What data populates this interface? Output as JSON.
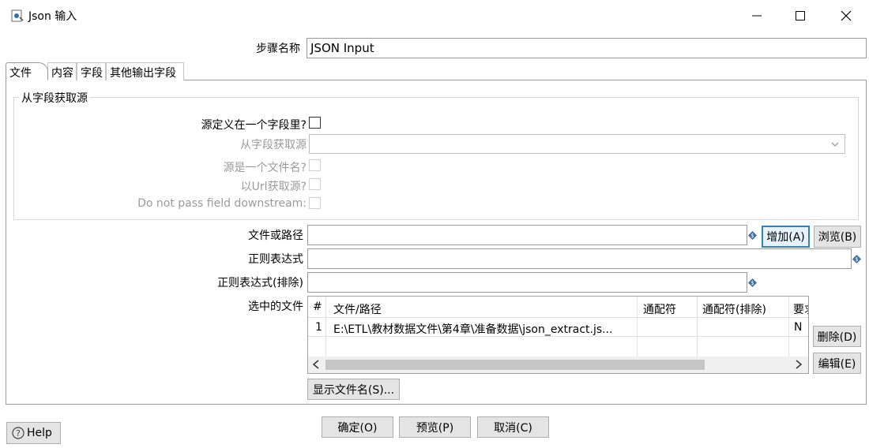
{
  "window": {
    "title": "Json 输入"
  },
  "step_name": {
    "label": "步骤名称",
    "value": "JSON Input"
  },
  "tabs": [
    {
      "label": "文件"
    },
    {
      "label": "内容"
    },
    {
      "label": "字段"
    },
    {
      "label": "其他输出字段"
    }
  ],
  "source_group": {
    "title": "从字段获取源",
    "source_in_field_label": "源定义在一个字段里?",
    "get_source_from_field_label": "从字段获取源",
    "source_is_filename_label": "源是一个文件名?",
    "read_source_as_url_label": "以Url获取源?",
    "do_not_pass_label": "Do not pass field downstream:"
  },
  "file": {
    "file_or_dir_label": "文件或路径",
    "regex_label": "正则表达式",
    "regex_exclude_label": "正则表达式(排除)",
    "selected_files_label": "选中的文件",
    "add_button": "增加(A)",
    "browse_button": "浏览(B)",
    "delete_button": "删除(D)",
    "edit_button": "编辑(E)",
    "show_filenames_button": "显示文件名(S)..."
  },
  "files_table": {
    "headers": {
      "num": "#",
      "path": "文件/路径",
      "wildcard": "通配符",
      "wildcard_exclude": "通配符(排除)",
      "required": "要求"
    },
    "rows": [
      {
        "num": "1",
        "path": "E:\\ETL\\教材数据文件\\第4章\\准备数据\\json_extract.js...",
        "wildcard": "",
        "wildcard_exclude": "",
        "required": "N"
      }
    ]
  },
  "footer": {
    "ok_button": "确定(O)",
    "preview_button": "预览(P)",
    "cancel_button": "取消(C)",
    "help_button": "Help"
  }
}
